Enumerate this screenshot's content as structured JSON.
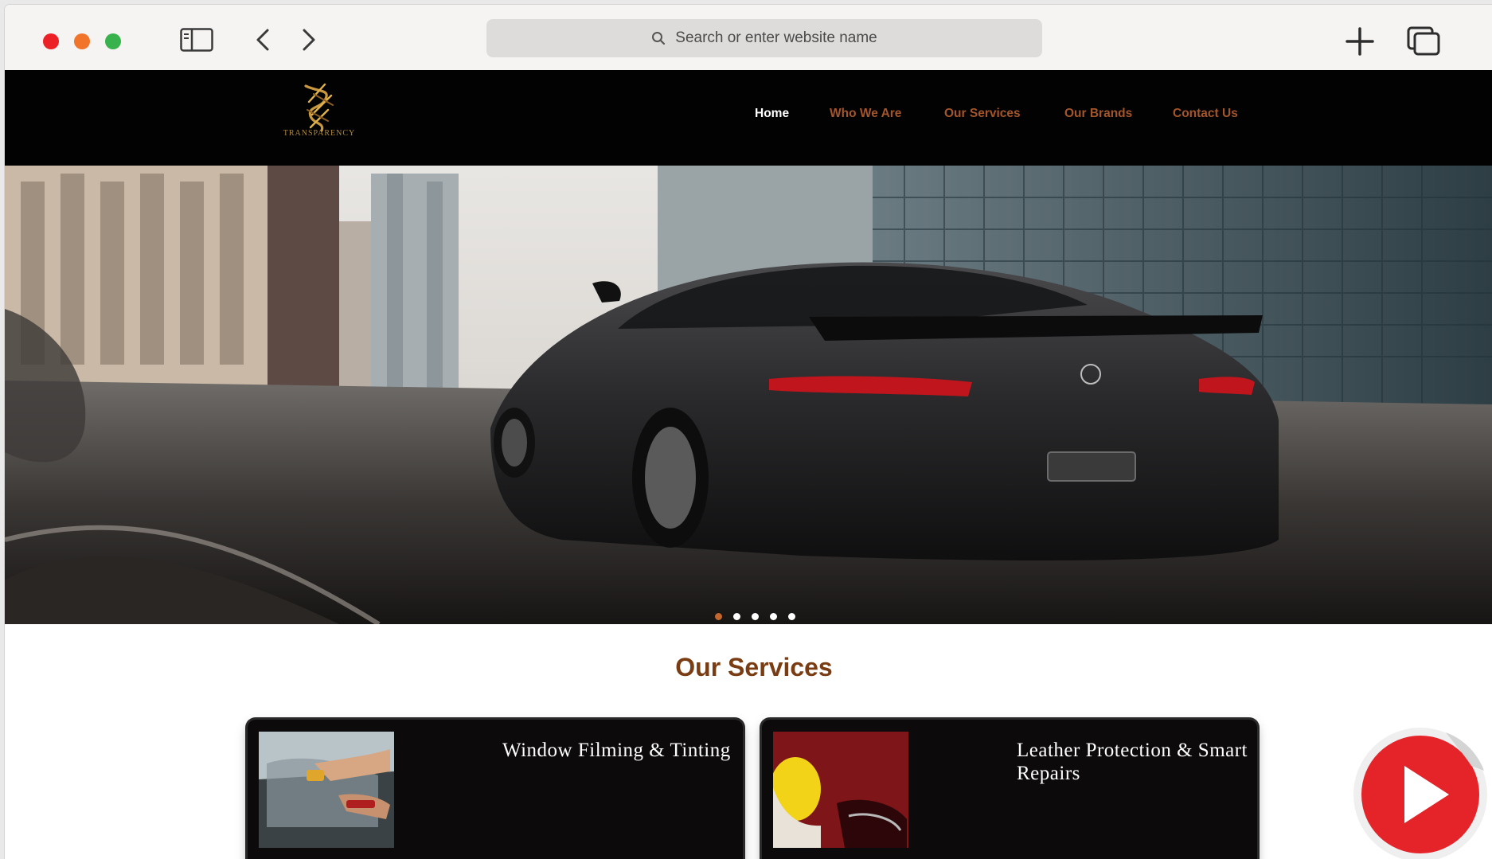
{
  "browser": {
    "address_placeholder": "Search or enter website name",
    "icons": [
      "sidebar-icon",
      "back-arrow-icon",
      "forward-arrow-icon",
      "search-icon",
      "plus-icon",
      "tabs-overview-icon"
    ]
  },
  "site": {
    "logo_text": "TRANSPARENCY",
    "nav": [
      {
        "label": "Home",
        "active": true
      },
      {
        "label": "Who We Are",
        "active": false
      },
      {
        "label": "Our Services",
        "active": false
      },
      {
        "label": "Our Brands",
        "active": false
      },
      {
        "label": "Contact Us",
        "active": false
      }
    ],
    "hero": {
      "slide_count": 5,
      "active_slide": 1
    },
    "services": {
      "title": "Our Services",
      "cards": [
        {
          "title": "Window Filming & Tinting"
        },
        {
          "title": "Leather Protection & Smart Repairs"
        }
      ]
    }
  },
  "colors": {
    "accent": "#a4552a",
    "title_brown": "#7a3d13",
    "header_bg": "#020202",
    "play_red": "#e42429"
  }
}
